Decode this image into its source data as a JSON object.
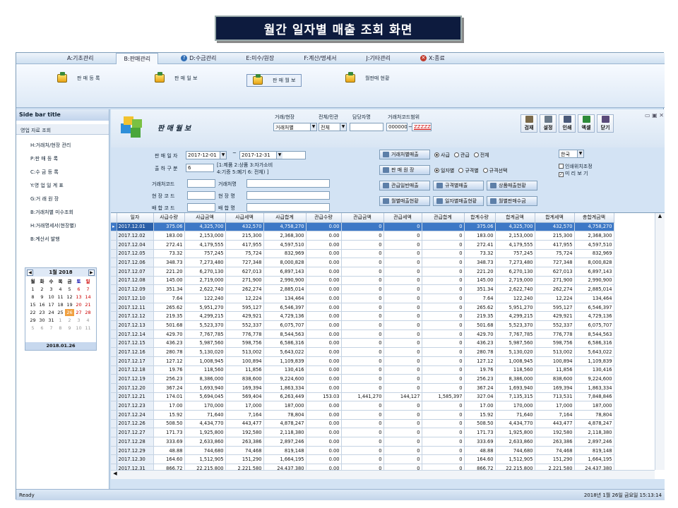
{
  "slide_title": "월간 일자별 매출 조회 화면",
  "menu": [
    {
      "label": "A:기초관리",
      "active": false,
      "icon": ""
    },
    {
      "label": "B:판매관리",
      "active": true,
      "icon": ""
    },
    {
      "label": "D:수금관리",
      "active": false,
      "icon": "help-icon"
    },
    {
      "label": "E:미수/원장",
      "active": false,
      "icon": ""
    },
    {
      "label": "F:계산/명세서",
      "active": false,
      "icon": ""
    },
    {
      "label": "J:기타관리",
      "active": false,
      "icon": ""
    },
    {
      "label": "X:종료",
      "active": false,
      "icon": "close-icon"
    }
  ],
  "ribbon": [
    {
      "label": "판 매 등 록",
      "selected": false
    },
    {
      "label": "판 매 일 보",
      "selected": false
    },
    {
      "label": "판 매 월 보",
      "selected": true
    },
    {
      "label": "월판매 현황",
      "selected": false
    }
  ],
  "sidebar": {
    "title": "Side bar title",
    "group": "영업 자료 조회",
    "items": [
      "H:거래처/현장 관리",
      "P:판 매 등 록",
      "C:수 금 등 록",
      "Y:영 업 일 계 표",
      "G:거 래 원 장",
      "B:거래처별 미수조회",
      "H:거래명세서(현장별)",
      "B:계산서 발행"
    ]
  },
  "calendar": {
    "title": "1월 2018",
    "weekdays": [
      "월",
      "화",
      "수",
      "목",
      "금",
      "토",
      "일"
    ],
    "days": [
      [
        "1",
        "2",
        "3",
        "4",
        "5",
        "6",
        "7"
      ],
      [
        "8",
        "9",
        "10",
        "11",
        "12",
        "13",
        "14"
      ],
      [
        "15",
        "16",
        "17",
        "18",
        "19",
        "20",
        "21"
      ],
      [
        "22",
        "23",
        "24",
        "25",
        "26",
        "27",
        "28"
      ],
      [
        "29",
        "30",
        "31",
        "1",
        "2",
        "3",
        "4"
      ],
      [
        "5",
        "6",
        "7",
        "8",
        "9",
        "10",
        "11"
      ]
    ],
    "today": "2018.01.26"
  },
  "form": {
    "window_title": "판 매 월 보",
    "client_site_label": "거래/현장",
    "client_site_value": "거래처별",
    "all_label": "전체/민관",
    "all_value": "전체",
    "manager_label": "담당자명",
    "client_code_range_label": "거래처코드범위",
    "client_code_from": "000000",
    "client_code_to": "ZZZZZ",
    "sale_date_label": "판 매 일 자",
    "date_from": "2017-12-01",
    "date_tilde": "~",
    "date_to": "2017-12-31",
    "ship_label": "출 하 구 분",
    "ship_value": "6",
    "ship_hint1": "[1:제품 2:상품 3:자가소비",
    "ship_hint2": "4:기증 5:폐기 6: 전체) ]",
    "client_code_label": "거래처코드",
    "client_name_label": "거래처명",
    "site_code_label": "현 장 코 드",
    "site_name_label": "현 장 명",
    "mix_code_label": "배 합 코 드",
    "mix_name_label": "배 합 명",
    "language": "한국",
    "print_adjust": "인쇄위치조정",
    "preview": "미 리 보 기",
    "preview_checked": true
  },
  "buttons": {
    "by_client": "거래처별매출",
    "by_site": "판 매 원 장",
    "gov_sales": "관급일반매출",
    "by_spec": "규격별매출",
    "by_product": "상품매출현황",
    "monthly_sales": "월별매출현황",
    "daily_sales": "일자별매출현황",
    "monthly_collect": "월별판매수금"
  },
  "radios1": [
    {
      "label": "사급",
      "on": true
    },
    {
      "label": "관급",
      "on": false
    },
    {
      "label": "전체",
      "on": false
    }
  ],
  "radios2": [
    {
      "label": "일자별",
      "on": true
    },
    {
      "label": "규격별",
      "on": false
    },
    {
      "label": "규격선택",
      "on": false
    }
  ],
  "toolbar": [
    {
      "label": "검재",
      "color": "#7b6a4a"
    },
    {
      "label": "설정",
      "color": "#6a7a8a"
    },
    {
      "label": "인쇄",
      "color": "#4a5a7a"
    },
    {
      "label": "엑셀",
      "color": "#2e8b3a"
    },
    {
      "label": "닫기",
      "color": "#5a4a7a"
    }
  ],
  "table": {
    "columns": [
      "일자",
      "사급수량",
      "사급금액",
      "사급세액",
      "사급합계",
      "관급수량",
      "관급금액",
      "관급세액",
      "관급합계",
      "합계수량",
      "합계금액",
      "합계세액",
      "총합계금액"
    ],
    "rows": [
      [
        "2017.12.01",
        "375.06",
        "4,325,700",
        "432,570",
        "4,758,270",
        "0.00",
        "0",
        "0",
        "0",
        "375.06",
        "4,325,700",
        "432,570",
        "4,758,270"
      ],
      [
        "2017.12.02",
        "183.00",
        "2,153,000",
        "215,300",
        "2,368,300",
        "0.00",
        "0",
        "0",
        "0",
        "183.00",
        "2,153,000",
        "215,300",
        "2,368,300"
      ],
      [
        "2017.12.04",
        "272.41",
        "4,179,555",
        "417,955",
        "4,597,510",
        "0.00",
        "0",
        "0",
        "0",
        "272.41",
        "4,179,555",
        "417,955",
        "4,597,510"
      ],
      [
        "2017.12.05",
        "73.32",
        "757,245",
        "75,724",
        "832,969",
        "0.00",
        "0",
        "0",
        "0",
        "73.32",
        "757,245",
        "75,724",
        "832,969"
      ],
      [
        "2017.12.06",
        "348.73",
        "7,273,480",
        "727,348",
        "8,000,828",
        "0.00",
        "0",
        "0",
        "0",
        "348.73",
        "7,273,480",
        "727,348",
        "8,000,828"
      ],
      [
        "2017.12.07",
        "221.20",
        "6,270,130",
        "627,013",
        "6,897,143",
        "0.00",
        "0",
        "0",
        "0",
        "221.20",
        "6,270,130",
        "627,013",
        "6,897,143"
      ],
      [
        "2017.12.08",
        "145.00",
        "2,719,000",
        "271,900",
        "2,990,900",
        "0.00",
        "0",
        "0",
        "0",
        "145.00",
        "2,719,000",
        "271,900",
        "2,990,900"
      ],
      [
        "2017.12.09",
        "351.34",
        "2,622,740",
        "262,274",
        "2,885,014",
        "0.00",
        "0",
        "0",
        "0",
        "351.34",
        "2,622,740",
        "262,274",
        "2,885,014"
      ],
      [
        "2017.12.10",
        "7.64",
        "122,240",
        "12,224",
        "134,464",
        "0.00",
        "0",
        "0",
        "0",
        "7.64",
        "122,240",
        "12,224",
        "134,464"
      ],
      [
        "2017.12.11",
        "265.62",
        "5,951,270",
        "595,127",
        "6,546,397",
        "0.00",
        "0",
        "0",
        "0",
        "265.62",
        "5,951,270",
        "595,127",
        "6,546,397"
      ],
      [
        "2017.12.12",
        "219.35",
        "4,299,215",
        "429,921",
        "4,729,136",
        "0.00",
        "0",
        "0",
        "0",
        "219.35",
        "4,299,215",
        "429,921",
        "4,729,136"
      ],
      [
        "2017.12.13",
        "501.68",
        "5,523,370",
        "552,337",
        "6,075,707",
        "0.00",
        "0",
        "0",
        "0",
        "501.68",
        "5,523,370",
        "552,337",
        "6,075,707"
      ],
      [
        "2017.12.14",
        "429.70",
        "7,767,785",
        "776,778",
        "8,544,563",
        "0.00",
        "0",
        "0",
        "0",
        "429.70",
        "7,767,785",
        "776,778",
        "8,544,563"
      ],
      [
        "2017.12.15",
        "436.23",
        "5,987,560",
        "598,756",
        "6,586,316",
        "0.00",
        "0",
        "0",
        "0",
        "436.23",
        "5,987,560",
        "598,756",
        "6,586,316"
      ],
      [
        "2017.12.16",
        "280.78",
        "5,130,020",
        "513,002",
        "5,643,022",
        "0.00",
        "0",
        "0",
        "0",
        "280.78",
        "5,130,020",
        "513,002",
        "5,643,022"
      ],
      [
        "2017.12.17",
        "127.12",
        "1,008,945",
        "100,894",
        "1,109,839",
        "0.00",
        "0",
        "0",
        "0",
        "127.12",
        "1,008,945",
        "100,894",
        "1,109,839"
      ],
      [
        "2017.12.18",
        "19.76",
        "118,560",
        "11,856",
        "130,416",
        "0.00",
        "0",
        "0",
        "0",
        "19.76",
        "118,560",
        "11,856",
        "130,416"
      ],
      [
        "2017.12.19",
        "256.23",
        "8,386,000",
        "838,600",
        "9,224,600",
        "0.00",
        "0",
        "0",
        "0",
        "256.23",
        "8,386,000",
        "838,600",
        "9,224,600"
      ],
      [
        "2017.12.20",
        "367.24",
        "1,693,940",
        "169,394",
        "1,863,334",
        "0.00",
        "0",
        "0",
        "0",
        "367.24",
        "1,693,940",
        "169,394",
        "1,863,334"
      ],
      [
        "2017.12.21",
        "174.01",
        "5,694,045",
        "569,404",
        "6,263,449",
        "153.03",
        "1,441,270",
        "144,127",
        "1,585,397",
        "327.04",
        "7,135,315",
        "713,531",
        "7,848,846"
      ],
      [
        "2017.12.23",
        "17.00",
        "170,000",
        "17,000",
        "187,000",
        "0.00",
        "0",
        "0",
        "0",
        "17.00",
        "170,000",
        "17,000",
        "187,000"
      ],
      [
        "2017.12.24",
        "15.92",
        "71,640",
        "7,164",
        "78,804",
        "0.00",
        "0",
        "0",
        "0",
        "15.92",
        "71,640",
        "7,164",
        "78,804"
      ],
      [
        "2017.12.26",
        "508.50",
        "4,434,770",
        "443,477",
        "4,878,247",
        "0.00",
        "0",
        "0",
        "0",
        "508.50",
        "4,434,770",
        "443,477",
        "4,878,247"
      ],
      [
        "2017.12.27",
        "171.73",
        "1,925,800",
        "192,580",
        "2,118,380",
        "0.00",
        "0",
        "0",
        "0",
        "171.73",
        "1,925,800",
        "192,580",
        "2,118,380"
      ],
      [
        "2017.12.28",
        "333.69",
        "2,633,860",
        "263,386",
        "2,897,246",
        "0.00",
        "0",
        "0",
        "0",
        "333.69",
        "2,633,860",
        "263,386",
        "2,897,246"
      ],
      [
        "2017.12.29",
        "48.88",
        "744,680",
        "74,468",
        "819,148",
        "0.00",
        "0",
        "0",
        "0",
        "48.88",
        "744,680",
        "74,468",
        "819,148"
      ],
      [
        "2017.12.30",
        "164.60",
        "1,512,905",
        "151,290",
        "1,664,195",
        "0.00",
        "0",
        "0",
        "0",
        "164.60",
        "1,512,905",
        "151,290",
        "1,664,195"
      ],
      [
        "2017.12.31",
        "866.72",
        "22,215,800",
        "2,221,580",
        "24,437,380",
        "0.00",
        "0",
        "0",
        "0",
        "866.72",
        "22,215,800",
        "2,221,580",
        "24,437,380"
      ]
    ]
  },
  "status": {
    "left": "Ready",
    "right": "2018년 1월 26일 금요일 15:13:14"
  }
}
